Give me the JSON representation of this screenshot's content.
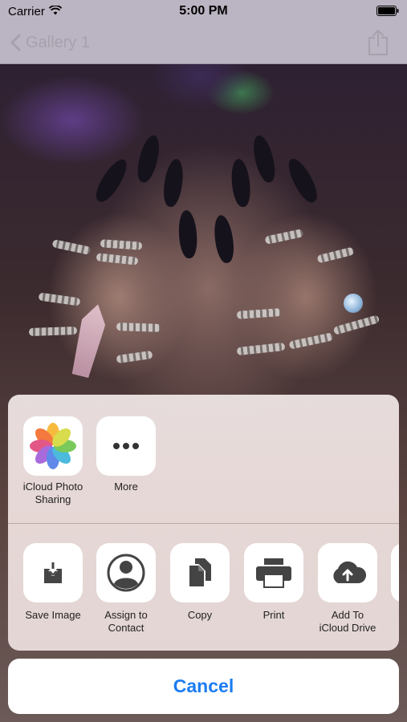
{
  "status_bar": {
    "carrier": "Carrier",
    "time": "5:00 PM"
  },
  "nav": {
    "back_label": "Gallery 1"
  },
  "share_sheet": {
    "apps": [
      {
        "label": "iCloud Photo\nSharing",
        "icon": "photos-icon"
      },
      {
        "label": "More",
        "icon": "more-icon"
      }
    ],
    "actions": [
      {
        "label": "Save Image",
        "icon": "save-image-icon"
      },
      {
        "label": "Assign to\nContact",
        "icon": "contact-icon"
      },
      {
        "label": "Copy",
        "icon": "copy-icon"
      },
      {
        "label": "Print",
        "icon": "print-icon"
      },
      {
        "label": "Add To\niCloud Drive",
        "icon": "icloud-drive-icon"
      }
    ]
  },
  "cancel_label": "Cancel",
  "colors": {
    "accent": "#1b7cf2"
  }
}
